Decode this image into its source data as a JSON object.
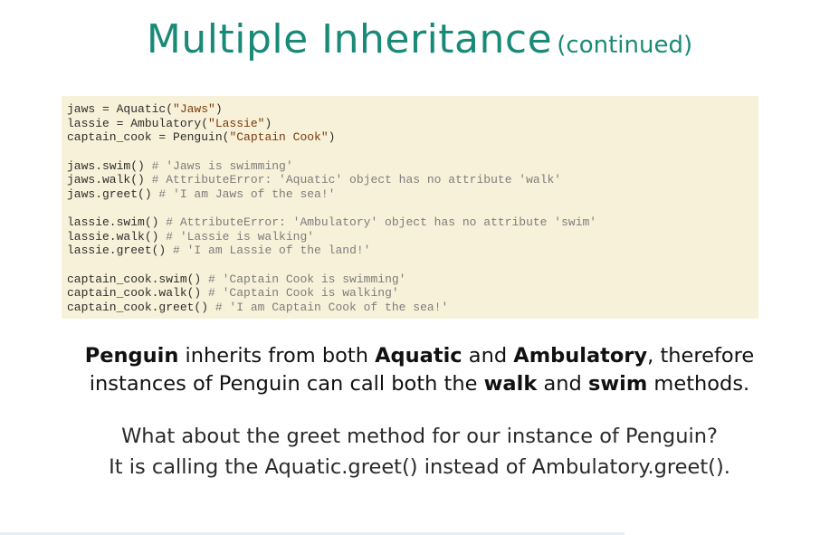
{
  "title": {
    "main": "Multiple Inheritance",
    "sub": "(continued)"
  },
  "code": {
    "block1": [
      {
        "pre": "jaws = Aquatic(",
        "str": "\"Jaws\"",
        "post": ")"
      },
      {
        "pre": "lassie = Ambulatory(",
        "str": "\"Lassie\"",
        "post": ")"
      },
      {
        "pre": "captain_cook = Penguin(",
        "str": "\"Captain Cook\"",
        "post": ")"
      }
    ],
    "block2": [
      {
        "code": "jaws.swim() ",
        "comment": "# 'Jaws is swimming'"
      },
      {
        "code": "jaws.walk() ",
        "comment": "# AttributeError: 'Aquatic' object has no attribute 'walk'"
      },
      {
        "code": "jaws.greet() ",
        "comment": "# 'I am Jaws of the sea!'"
      }
    ],
    "block3": [
      {
        "code": "lassie.swim() ",
        "comment": "# AttributeError: 'Ambulatory' object has no attribute 'swim'"
      },
      {
        "code": "lassie.walk() ",
        "comment": "# 'Lassie is walking'"
      },
      {
        "code": "lassie.greet() ",
        "comment": "# 'I am Lassie of the land!'"
      }
    ],
    "block4": [
      {
        "code": "captain_cook.swim() ",
        "comment": "# 'Captain Cook is swimming'"
      },
      {
        "code": "captain_cook.walk() ",
        "comment": "# 'Captain Cook is walking'"
      },
      {
        "code": "captain_cook.greet() ",
        "comment": "# 'I am Captain Cook of the sea!'"
      }
    ]
  },
  "explanation": {
    "line1": {
      "b1": "Penguin",
      "t1": " inherits from both ",
      "b2": "Aquatic",
      "t2": " and ",
      "b3": "Ambulatory",
      "t3": ", therefore"
    },
    "line2": {
      "t1": "instances of Penguin can call both the ",
      "b1": "walk",
      "t2": " and ",
      "b2": "swim",
      "t3": " methods."
    }
  },
  "question": {
    "line1": "What about the greet method for our instance of Penguin?",
    "line2": "It is calling the Aquatic.greet() instead of Ambulatory.greet()."
  },
  "colors": {
    "title": "#1a8a78",
    "code_background": "#f8f1d9",
    "code_string": "#7a3a0a",
    "code_comment": "#7c7c7c"
  }
}
